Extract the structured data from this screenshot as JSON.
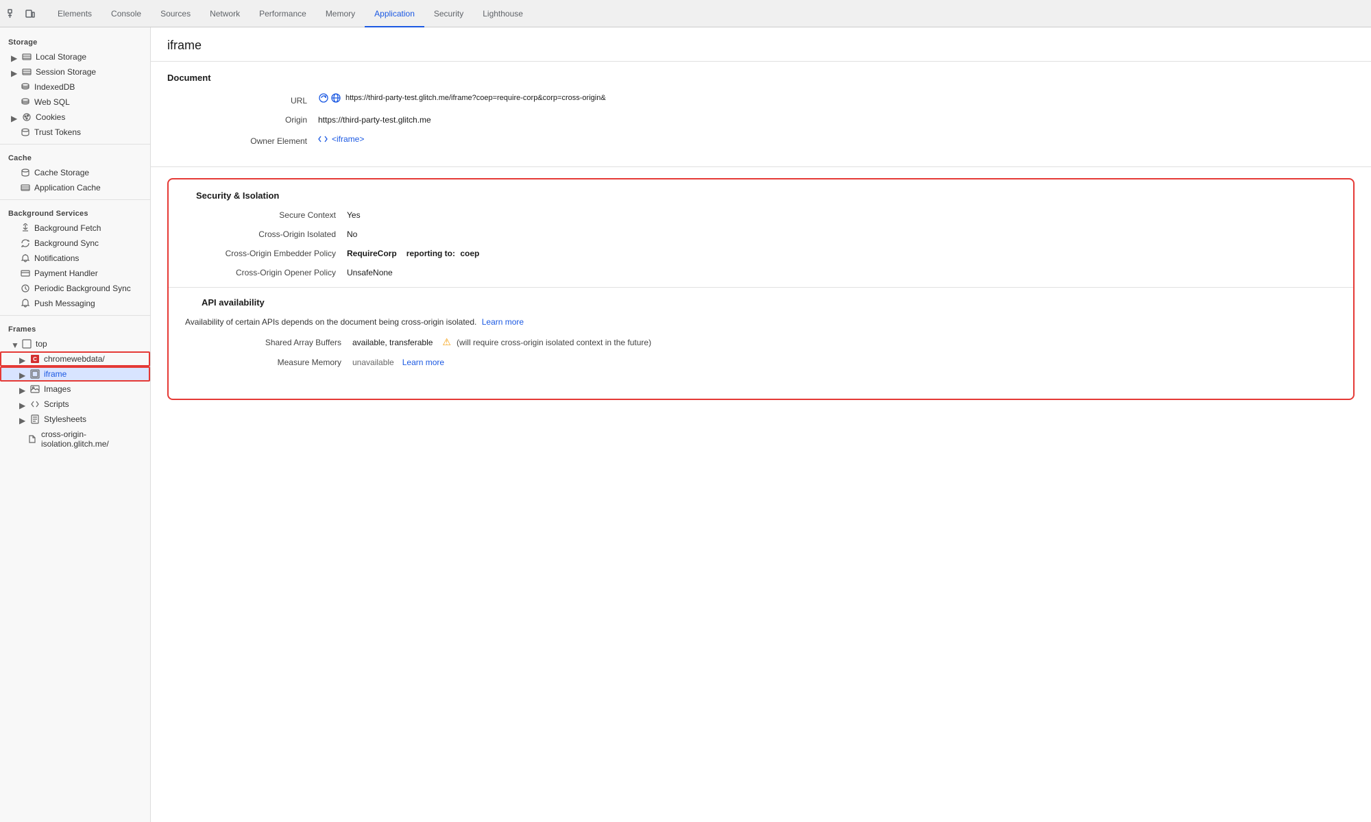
{
  "tabs": {
    "items": [
      {
        "label": "Elements",
        "active": false
      },
      {
        "label": "Console",
        "active": false
      },
      {
        "label": "Sources",
        "active": false
      },
      {
        "label": "Network",
        "active": false
      },
      {
        "label": "Performance",
        "active": false
      },
      {
        "label": "Memory",
        "active": false
      },
      {
        "label": "Application",
        "active": true
      },
      {
        "label": "Security",
        "active": false
      },
      {
        "label": "Lighthouse",
        "active": false
      }
    ]
  },
  "sidebar": {
    "storage_label": "Storage",
    "cache_label": "Cache",
    "bg_services_label": "Background Services",
    "frames_label": "Frames",
    "items": {
      "local_storage": "Local Storage",
      "session_storage": "Session Storage",
      "indexed_db": "IndexedDB",
      "web_sql": "Web SQL",
      "cookies": "Cookies",
      "trust_tokens": "Trust Tokens",
      "cache_storage": "Cache Storage",
      "application_cache": "Application Cache",
      "background_fetch": "Background Fetch",
      "background_sync": "Background Sync",
      "notifications": "Notifications",
      "payment_handler": "Payment Handler",
      "periodic_bg_sync": "Periodic Background Sync",
      "push_messaging": "Push Messaging",
      "top": "top",
      "chromewebdata": "chromewebdata/",
      "iframe": "iframe",
      "images": "Images",
      "scripts": "Scripts",
      "stylesheets": "Stylesheets",
      "cross_origin": "cross-origin-isolation.glitch.me/"
    }
  },
  "content": {
    "iframe_title": "iframe",
    "document_section": "Document",
    "url_label": "URL",
    "url_value": "https://third-party-test.glitch.me/iframe?coep=require-corp&corp=cross-origin&",
    "origin_label": "Origin",
    "origin_value": "https://third-party-test.glitch.me",
    "owner_element_label": "Owner Element",
    "owner_element_value": "<iframe>",
    "security_isolation_title": "Security & Isolation",
    "secure_context_label": "Secure Context",
    "secure_context_value": "Yes",
    "cross_origin_isolated_label": "Cross-Origin Isolated",
    "cross_origin_isolated_value": "No",
    "coep_label": "Cross-Origin Embedder Policy",
    "coep_value": "RequireCorp",
    "coep_reporting_prefix": "reporting to:",
    "coep_reporting_value": "coep",
    "coop_label": "Cross-Origin Opener Policy",
    "coop_value": "UnsafeNone",
    "api_availability_title": "API availability",
    "api_desc": "Availability of certain APIs depends on the document being cross-origin isolated.",
    "api_learn_more": "Learn more",
    "shared_array_label": "Shared Array Buffers",
    "shared_array_value": "available, transferable",
    "shared_array_warning": "⚠",
    "shared_array_warning_text": "will require cross-origin isolated context in the future)",
    "measure_memory_label": "Measure Memory",
    "measure_memory_value": "unavailable",
    "measure_memory_link": "Learn more"
  }
}
